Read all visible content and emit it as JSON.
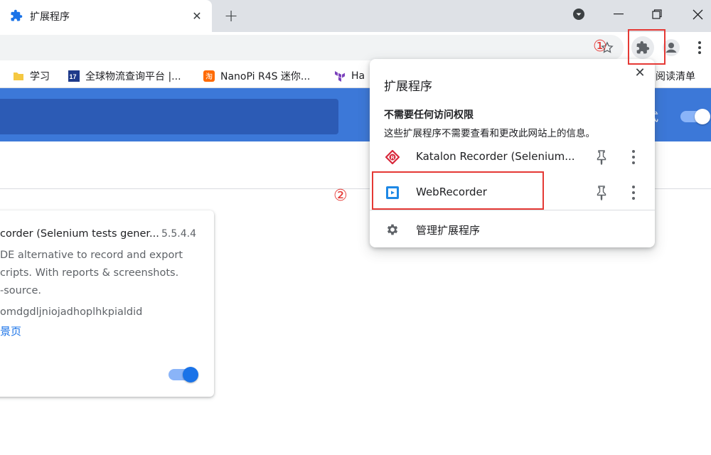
{
  "tab": {
    "title": "扩展程序"
  },
  "bookmarks": [
    {
      "label": "学习"
    },
    {
      "label": "全球物流查询平台 |..."
    },
    {
      "label": "NanoPi R4S 迷你..."
    },
    {
      "label": "Ha"
    },
    {
      "label": "阅读清单"
    }
  ],
  "header": {
    "devmode_label": "式"
  },
  "card": {
    "name": "corder (Selenium tests gener...",
    "version": "5.5.4.4",
    "desc_lines": [
      "DE alternative to record and export",
      "cripts. With reports & screenshots.",
      "-source."
    ],
    "id": "omdgdljniojadhoplhkpialdid",
    "link": "景页"
  },
  "popup": {
    "title": "扩展程序",
    "heading": "不需要任何访问权限",
    "subtitle": "这些扩展程序不需要查看和更改此网站上的信息。",
    "extensions": [
      {
        "name": "Katalon Recorder (Selenium..."
      },
      {
        "name": "WebRecorder"
      }
    ],
    "manage_label": "管理扩展程序"
  },
  "annotations": {
    "one": "①",
    "two": "②"
  },
  "colors": {
    "accent": "#1a73e8",
    "header": "#3c78d8",
    "highlight": "#e53935"
  }
}
